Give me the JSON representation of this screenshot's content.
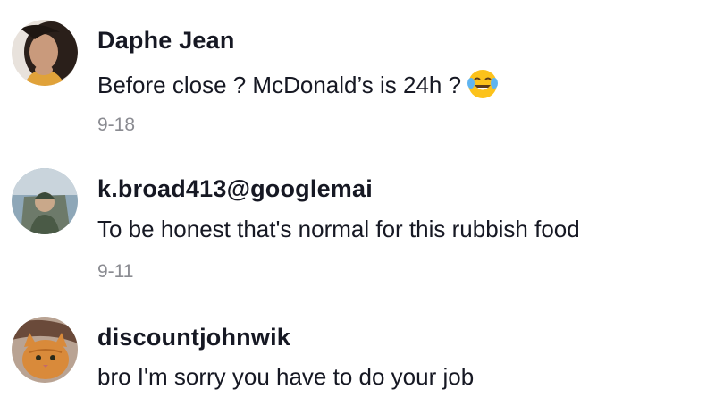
{
  "comments": [
    {
      "username": "Daphe Jean",
      "text": "Before close ? McDonald’s is 24h ?",
      "emoji": "face-with-tears-of-joy",
      "date": "9-18"
    },
    {
      "username": "k.broad413@googlemai",
      "text": "To be honest that's normal for this rubbish food",
      "date": "9-11"
    },
    {
      "username": "discountjohnwik",
      "text": "bro I'm sorry you have to do your job"
    }
  ],
  "colors": {
    "username": "#161823",
    "text": "#161823",
    "date": "#8a8b91",
    "background": "#ffffff"
  }
}
